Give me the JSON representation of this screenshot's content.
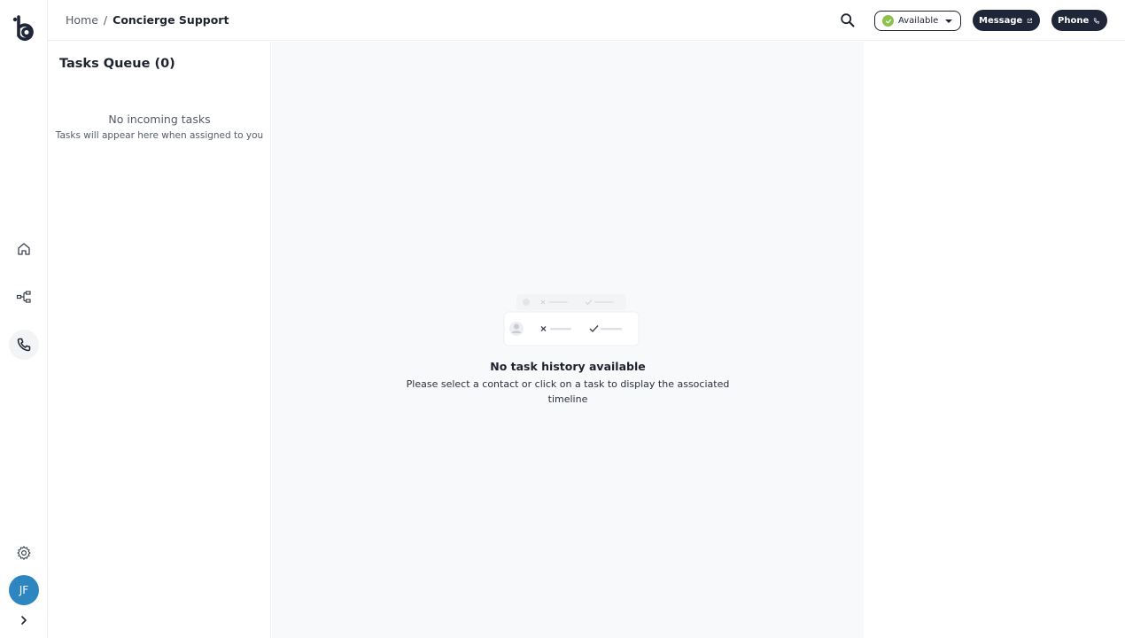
{
  "app": {
    "avatar_initials": "JF",
    "brand_color": "#1f2637"
  },
  "header": {
    "breadcrumb_home": "Home",
    "breadcrumb_sep": "/",
    "breadcrumb_current": "Concierge Support",
    "status": {
      "label": "Available",
      "color": "#8bc34a"
    },
    "message_label": "Message",
    "phone_label": "Phone"
  },
  "sidebar": {
    "items": [
      {
        "icon": "home-icon"
      },
      {
        "icon": "workflow-icon"
      },
      {
        "icon": "phone-icon",
        "active": true
      },
      {
        "icon": "gear-icon"
      }
    ]
  },
  "queue": {
    "title": "Tasks Queue (0)",
    "empty_title": "No incoming tasks",
    "empty_subtitle": "Tasks will appear here when assigned to you"
  },
  "main": {
    "empty_title": "No task history available",
    "empty_subtitle": "Please select a contact or click on a task to display the associated timeline"
  }
}
